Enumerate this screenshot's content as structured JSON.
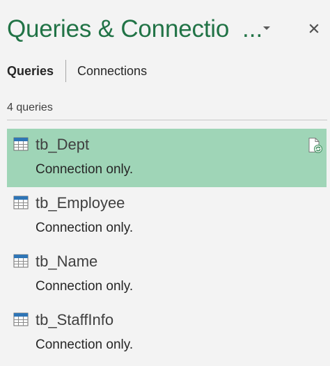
{
  "pane": {
    "title": "Queries & Connectio",
    "title_ellipsis": "...",
    "menu_icon": "chevron-down-icon",
    "close_icon": "close-icon",
    "accent_color": "#217346",
    "selected_color": "#9fd5b7"
  },
  "tabs": {
    "queries_label": "Queries",
    "connections_label": "Connections",
    "active": "Queries"
  },
  "summary": {
    "count_text": "4 queries"
  },
  "queries": [
    {
      "name": "tb_Dept",
      "status": "Connection only.",
      "selected": true,
      "icon": "table-icon"
    },
    {
      "name": "tb_Employee",
      "status": "Connection only.",
      "selected": false,
      "icon": "table-icon"
    },
    {
      "name": "tb_Name",
      "status": "Connection only.",
      "selected": false,
      "icon": "table-icon"
    },
    {
      "name": "tb_StaffInfo",
      "status": "Connection only.",
      "selected": false,
      "icon": "table-icon"
    }
  ]
}
